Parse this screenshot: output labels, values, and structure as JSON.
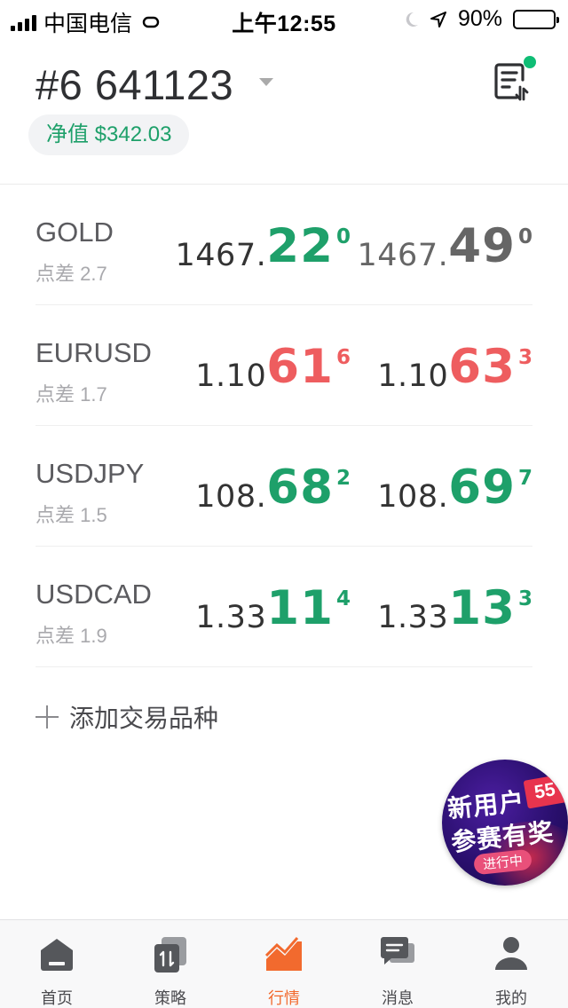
{
  "status_bar": {
    "carrier": "中国电信",
    "time": "上午12:55",
    "battery": "90%",
    "battery_level": 0.9,
    "icons": [
      "signal-icon",
      "hotspot-icon",
      "moon-icon",
      "location-arrow-icon",
      "battery-icon"
    ]
  },
  "header": {
    "account": "#6 641123",
    "equity": "净值 $342.03",
    "order_icon": "order-list-icon",
    "notification_dot_color": "#0fbd75"
  },
  "colors": {
    "up": "#1ea06a",
    "down": "#ee5d5f",
    "neutral": "#333333",
    "muted": "#666666",
    "accent": "#f26a2e"
  },
  "quotes": [
    {
      "symbol": "GOLD",
      "spread": "点差 2.7",
      "bid": {
        "main": "1467.",
        "big": "22",
        "sup": "0",
        "color": "up"
      },
      "ask": {
        "main": "1467.",
        "big": "49",
        "sup": "0",
        "color": "muted"
      }
    },
    {
      "symbol": "EURUSD",
      "spread": "点差 1.7",
      "bid": {
        "main": "1.10",
        "big": "61",
        "sup": "6",
        "color": "down"
      },
      "ask": {
        "main": "1.10",
        "big": "63",
        "sup": "3",
        "color": "down"
      }
    },
    {
      "symbol": "USDJPY",
      "spread": "点差 1.5",
      "bid": {
        "main": "108.",
        "big": "68",
        "sup": "2",
        "color": "up"
      },
      "ask": {
        "main": "108.",
        "big": "69",
        "sup": "7",
        "color": "up"
      }
    },
    {
      "symbol": "USDCAD",
      "spread": "点差 1.9",
      "bid": {
        "main": "1.33",
        "big": "11",
        "sup": "4",
        "color": "up"
      },
      "ask": {
        "main": "1.33",
        "big": "13",
        "sup": "3",
        "color": "up"
      }
    }
  ],
  "add_label": "添加交易品种",
  "promo": {
    "line1": "新用户",
    "line2": "参赛有奖",
    "status": "进行中",
    "number": "55"
  },
  "tabs": [
    {
      "label": "首页",
      "icon": "home-icon",
      "active": false
    },
    {
      "label": "策略",
      "icon": "strategy-icon",
      "active": false
    },
    {
      "label": "行情",
      "icon": "market-chart-icon",
      "active": true
    },
    {
      "label": "消息",
      "icon": "message-icon",
      "active": false
    },
    {
      "label": "我的",
      "icon": "user-icon",
      "active": false
    }
  ]
}
